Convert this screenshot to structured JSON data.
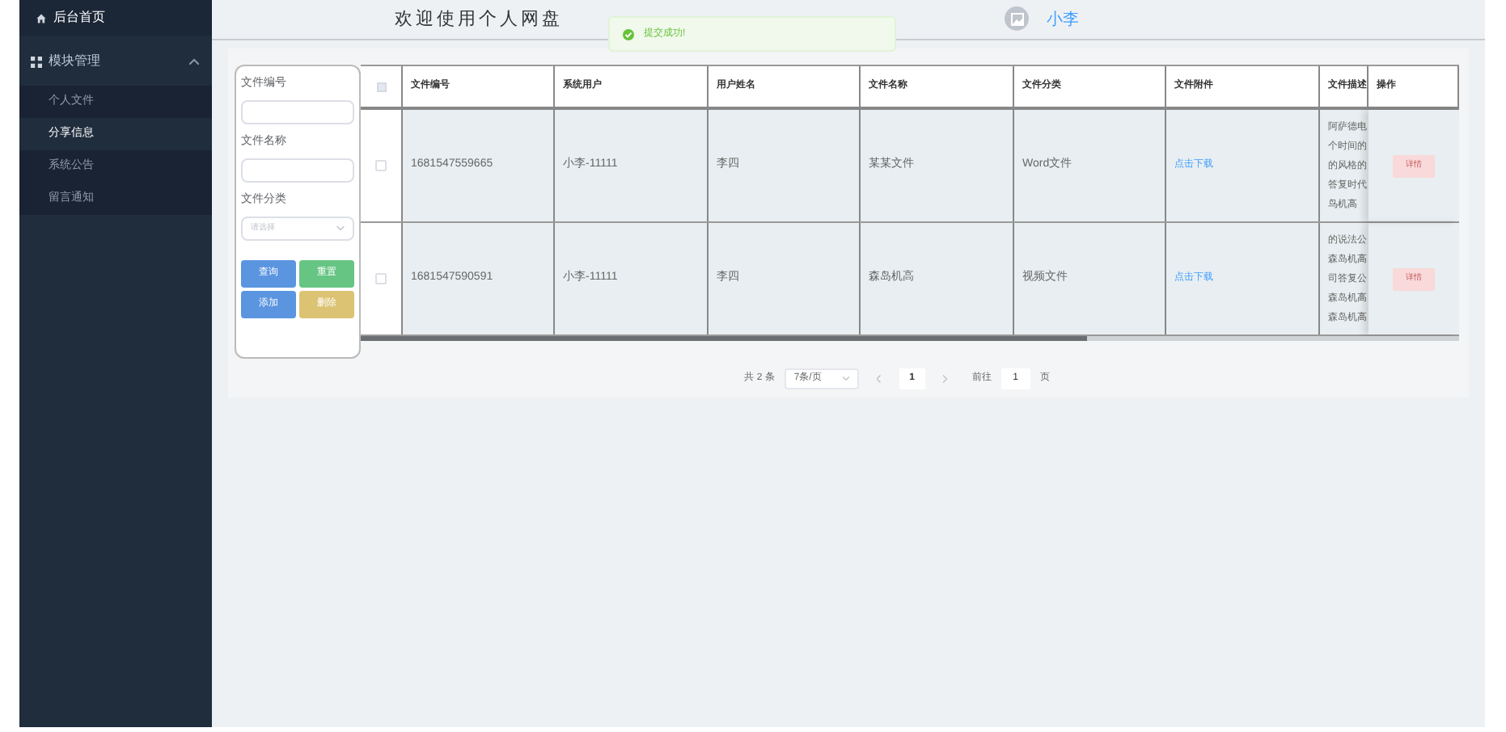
{
  "sidebar": {
    "home": "后台首页",
    "group": {
      "label": "模块管理",
      "expanded": true
    },
    "items": [
      {
        "label": "个人文件",
        "selected": false
      },
      {
        "label": "分享信息",
        "selected": true
      },
      {
        "label": "系统公告",
        "selected": false
      },
      {
        "label": "留言通知",
        "selected": false
      }
    ]
  },
  "header": {
    "title": "欢迎使用个人网盘",
    "user": "小李"
  },
  "toast": {
    "message": "提交成功!"
  },
  "filters": [
    {
      "label": "文件编号",
      "kind": "input"
    },
    {
      "label": "文件名称",
      "kind": "input"
    },
    {
      "label": "文件分类",
      "kind": "select",
      "placeholder": "请选择"
    }
  ],
  "buttons": [
    {
      "label": "查询",
      "kind": "primary"
    },
    {
      "label": "重置",
      "kind": "success"
    },
    {
      "label": "添加",
      "kind": "primary"
    },
    {
      "label": "删除",
      "kind": "warning"
    }
  ],
  "table": {
    "select_all": {
      "checked": false
    },
    "columns": [
      "文件编号",
      "系统用户",
      "用户姓名",
      "文件名称",
      "文件分类",
      "文件附件",
      "文件描述",
      "操作"
    ],
    "rows": [
      {
        "checked": false,
        "cells": [
          "1681547559665",
          "小李-11111",
          "李四",
          "某某文件",
          "Word文件"
        ],
        "link": "点击下载",
        "description": [
          "阿萨德电",
          "个时间的",
          "的风格的",
          "答复时代",
          "鸟机高"
        ],
        "action": "详情"
      },
      {
        "checked": false,
        "cells": [
          "1681547590591",
          "小李-11111",
          "李四",
          "森岛机高",
          "视频文件"
        ],
        "link": "点击下载",
        "description": [
          "的说法公",
          "森岛机高",
          "司答复公",
          "森岛机高",
          "森岛机高"
        ],
        "action": "详情"
      }
    ]
  },
  "pagination": {
    "total": "共 2 条",
    "page_size": "7条/页",
    "current": "1",
    "goto_label": "前往",
    "goto_value": "1",
    "page_unit": "页"
  }
}
